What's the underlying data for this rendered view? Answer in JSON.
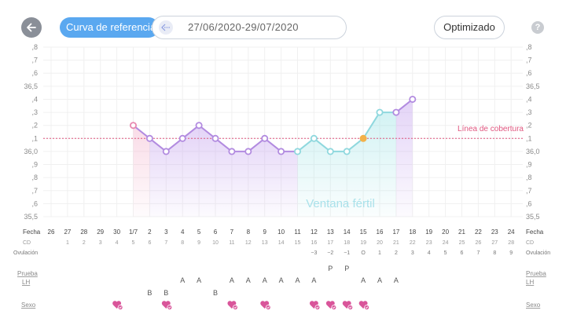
{
  "header": {
    "back_icon": "arrow-left-icon",
    "reference_curve_label": "Curva de referencia",
    "date_range": "27/06/2020-29/07/2020",
    "optimized_label": "Optimizado",
    "help_label": "?"
  },
  "y_axis_left": [
    ",8",
    ",7",
    ",6",
    "36,5",
    ",4",
    ",3",
    ",2",
    ",1",
    "36,0",
    ",9",
    ",8",
    ",7",
    ",6",
    "35,5"
  ],
  "y_axis_right": [
    ",8",
    ",7",
    ",6",
    "36,5",
    ",4",
    ",3",
    ",2",
    ",1",
    "36,0",
    ",9",
    ",8",
    ",7",
    ",6",
    "35,5"
  ],
  "cover_line": {
    "label": "Línea de cobertura",
    "value": 36.1,
    "color": "#e0567f"
  },
  "fertile_window_label": "Ventana fértil",
  "rows": {
    "fecha": "Fecha",
    "cd": "CD",
    "ovulacion": "Ovulación",
    "prueba_lh": [
      "Prueba",
      "LH"
    ],
    "sexo": "Sexo"
  },
  "days": [
    {
      "date": "26",
      "cd": "",
      "ov": "",
      "lh": "",
      "sex": false
    },
    {
      "date": "27",
      "cd": "1",
      "ov": "",
      "lh": "",
      "sex": false
    },
    {
      "date": "28",
      "cd": "2",
      "ov": "",
      "lh": "",
      "sex": false
    },
    {
      "date": "29",
      "cd": "3",
      "ov": "",
      "lh": "",
      "sex": false
    },
    {
      "date": "30",
      "cd": "4",
      "ov": "",
      "lh": "",
      "sex": true
    },
    {
      "date": "1/7",
      "cd": "5",
      "ov": "",
      "lh": "",
      "sex": false
    },
    {
      "date": "2",
      "cd": "6",
      "ov": "",
      "lh": "B",
      "sex": false
    },
    {
      "date": "3",
      "cd": "7",
      "ov": "",
      "lh": "B",
      "sex": true
    },
    {
      "date": "4",
      "cd": "8",
      "ov": "",
      "lh": "A",
      "sex": false
    },
    {
      "date": "5",
      "cd": "9",
      "ov": "",
      "lh": "A",
      "sex": false
    },
    {
      "date": "6",
      "cd": "10",
      "ov": "",
      "lh": "B",
      "sex": false
    },
    {
      "date": "7",
      "cd": "11",
      "ov": "",
      "lh": "A",
      "sex": true
    },
    {
      "date": "8",
      "cd": "12",
      "ov": "",
      "lh": "A",
      "sex": false
    },
    {
      "date": "9",
      "cd": "13",
      "ov": "",
      "lh": "A",
      "sex": true
    },
    {
      "date": "10",
      "cd": "14",
      "ov": "",
      "lh": "A",
      "sex": false
    },
    {
      "date": "11",
      "cd": "15",
      "ov": "",
      "lh": "A",
      "sex": false
    },
    {
      "date": "12",
      "cd": "16",
      "ov": "−3",
      "lh": "A",
      "sex": true
    },
    {
      "date": "13",
      "cd": "17",
      "ov": "−2",
      "lh": "P",
      "sex": true
    },
    {
      "date": "14",
      "cd": "18",
      "ov": "−1",
      "lh": "P",
      "sex": true
    },
    {
      "date": "15",
      "cd": "19",
      "ov": "O",
      "lh": "A",
      "sex": true
    },
    {
      "date": "16",
      "cd": "20",
      "ov": "1",
      "lh": "A",
      "sex": false
    },
    {
      "date": "17",
      "cd": "21",
      "ov": "2",
      "lh": "A",
      "sex": false
    },
    {
      "date": "18",
      "cd": "22",
      "ov": "3",
      "lh": "",
      "sex": false
    },
    {
      "date": "19",
      "cd": "23",
      "ov": "4",
      "lh": "",
      "sex": false
    },
    {
      "date": "20",
      "cd": "24",
      "ov": "5",
      "lh": "",
      "sex": false
    },
    {
      "date": "21",
      "cd": "25",
      "ov": "6",
      "lh": "",
      "sex": false
    },
    {
      "date": "22",
      "cd": "26",
      "ov": "7",
      "lh": "",
      "sex": false
    },
    {
      "date": "23",
      "cd": "27",
      "ov": "8",
      "lh": "",
      "sex": false
    },
    {
      "date": "24",
      "cd": "28",
      "ov": "9",
      "lh": "",
      "sex": false
    }
  ],
  "chart_data": {
    "type": "line",
    "x_dates": [
      "1/7",
      "2",
      "3",
      "4",
      "5",
      "6",
      "7",
      "8",
      "9",
      "10",
      "11",
      "12",
      "13",
      "14",
      "15",
      "16",
      "17",
      "18"
    ],
    "series": [
      {
        "values": [
          36.2,
          36.1,
          36.0,
          36.1,
          36.2,
          36.1,
          36.0,
          36.0,
          36.1,
          36.0,
          36.0,
          36.1,
          36.0,
          36.0,
          36.1,
          36.3,
          36.3,
          36.4
        ]
      }
    ],
    "ylim": [
      35.5,
      36.8
    ],
    "colors": {
      "pre": "#b28be0",
      "fertile": "#8fd8de",
      "post": "#8fd8de",
      "first_point": "#e889b0",
      "ovulation_point": "#f3b14a",
      "grid": "#f0f0f0"
    }
  }
}
